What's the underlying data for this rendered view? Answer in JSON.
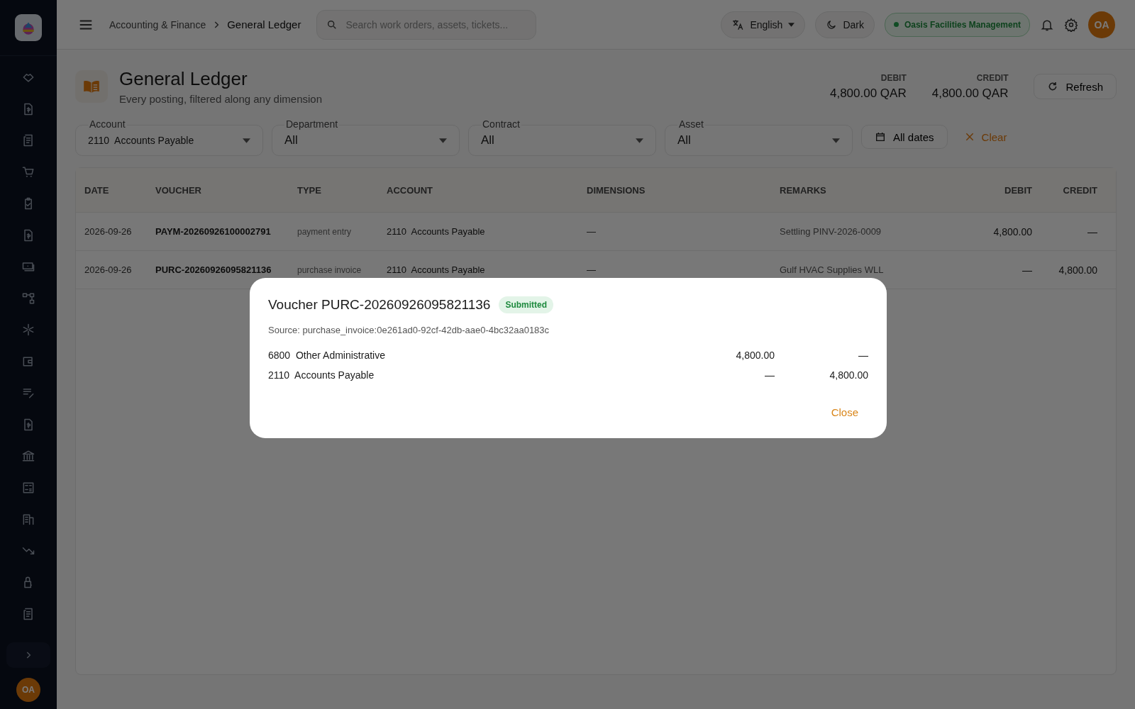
{
  "sidebar": {
    "user_initials": "OA"
  },
  "topbar": {
    "breadcrumb": [
      "Accounting & Finance",
      "General Ledger"
    ],
    "search": {
      "placeholder": "Search work orders, assets, tickets..."
    },
    "language": "English",
    "theme": "Dark",
    "organization": "Oasis Facilities Management",
    "user_initials": "OA"
  },
  "header": {
    "title": "General Ledger",
    "subtitle": "Every posting, filtered along any dimension",
    "totals": [
      {
        "label": "DEBIT",
        "value": "4,800.00 QAR"
      },
      {
        "label": "CREDIT",
        "value": "4,800.00 QAR"
      }
    ],
    "refresh": "Refresh"
  },
  "filters": {
    "selects": [
      {
        "label": "Account",
        "value": "2110  Accounts Payable",
        "kind": "small"
      },
      {
        "label": "Department",
        "value": "All",
        "kind": "large"
      },
      {
        "label": "Contract",
        "value": "All",
        "kind": "large"
      },
      {
        "label": "Asset",
        "value": "All",
        "kind": "large"
      }
    ],
    "dates": "All dates",
    "clear": "Clear"
  },
  "table": {
    "columns": [
      "DATE",
      "VOUCHER",
      "TYPE",
      "ACCOUNT",
      "DIMENSIONS",
      "REMARKS",
      "DEBIT",
      "CREDIT"
    ],
    "rows": [
      [
        "2026-09-26",
        "PAYM-20260926100002791",
        "payment entry",
        "2110  Accounts Payable",
        "—",
        "Settling PINV-2026-0009",
        "4,800.00",
        "—"
      ],
      [
        "2026-09-26",
        "PURC-20260926095821136",
        "purchase invoice",
        "2110  Accounts Payable",
        "—",
        "Gulf HVAC Supplies WLL",
        "—",
        "4,800.00"
      ]
    ]
  },
  "modal": {
    "title": "Voucher PURC-20260926095821136",
    "status": "Submitted",
    "source": "Source: purchase_invoice:0e261ad0-92cf-42db-aae0-4bc32aa0183c",
    "lines": [
      {
        "account": "6800  Other Administrative",
        "debit": "4,800.00",
        "credit": "—"
      },
      {
        "account": "2110  Accounts Payable",
        "debit": "—",
        "credit": "4,800.00"
      }
    ],
    "close": "Close"
  }
}
